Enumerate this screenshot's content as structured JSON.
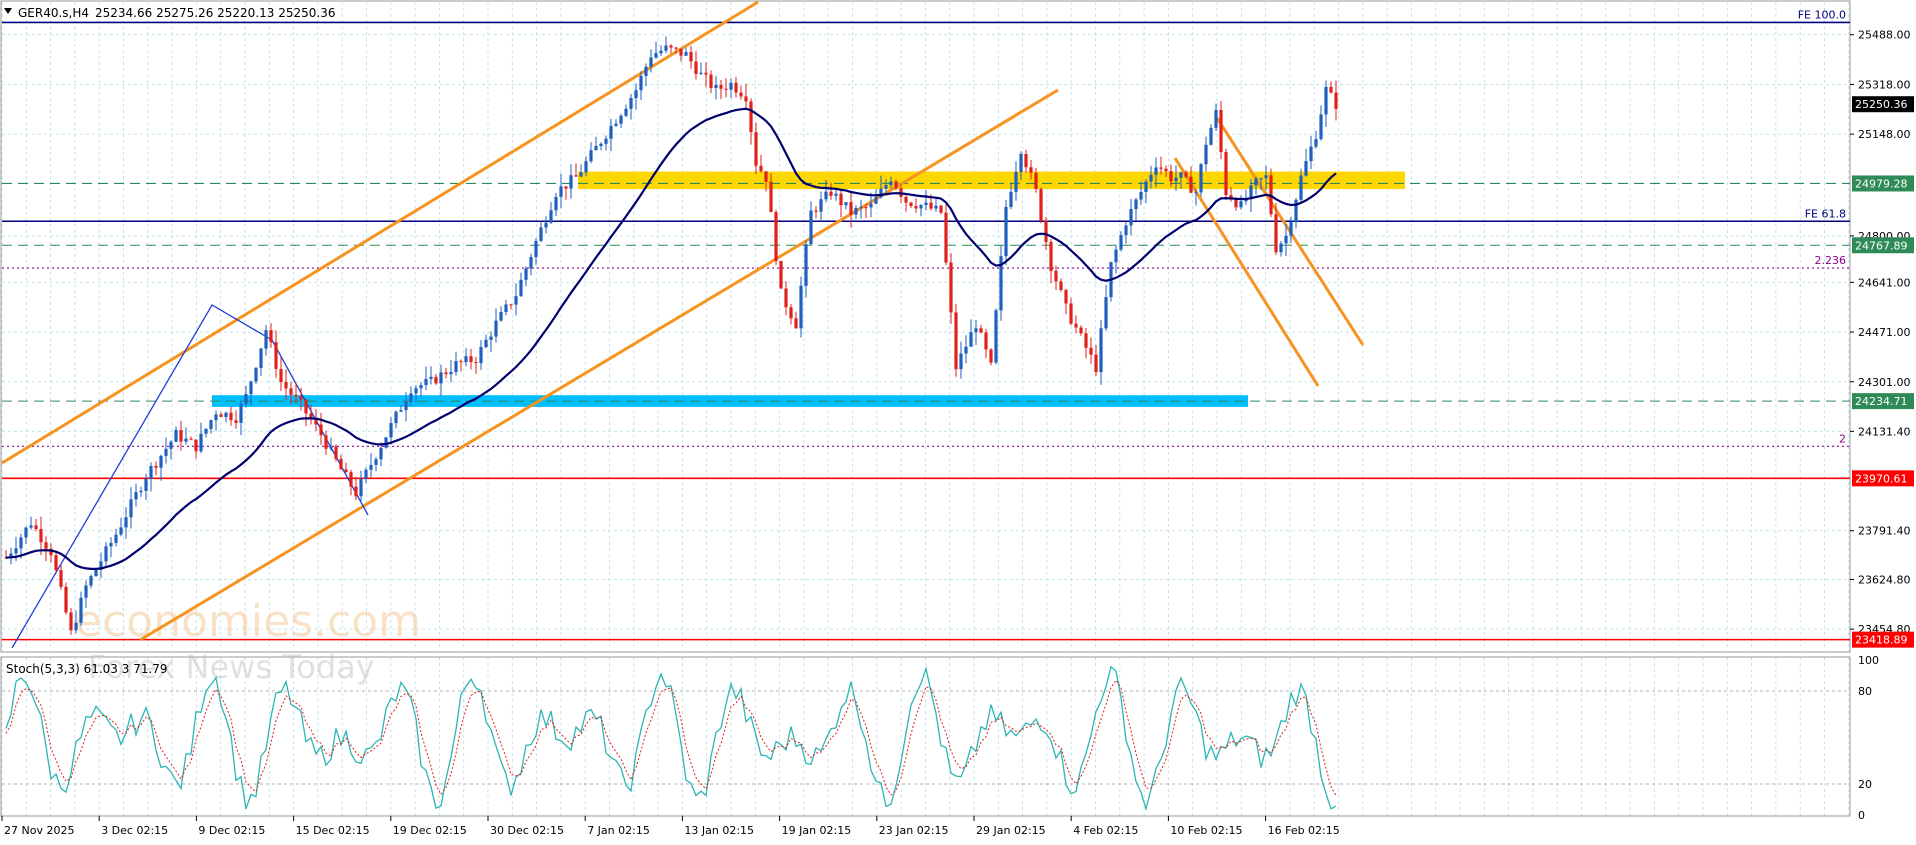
{
  "header": {
    "symbol": "GER40.s,H4",
    "ohlc": "25234.66 25275.26 25220.13 25250.36"
  },
  "watermark": "economies.com",
  "watermark_sub": "Forex News Today",
  "stoch_label": "Stoch(5,3,3) 61.03 3 71.79",
  "chart_data": [
    {
      "type": "candlestick",
      "symbol": "GER40.s",
      "timeframe": "H4",
      "ohlc_last": {
        "open": 25234.66,
        "high": 25275.26,
        "low": 25220.13,
        "close": 25250.36
      },
      "x_tick_labels": [
        "27 Nov 2025",
        "3 Dec 02:15",
        "9 Dec 02:15",
        "15 Dec 02:15",
        "19 Dec 02:15",
        "30 Dec 02:15",
        "7 Jan 02:15",
        "13 Jan 02:15",
        "19 Jan 02:15",
        "23 Jan 02:15",
        "29 Jan 02:15",
        "4 Feb 02:15",
        "10 Feb 02:15",
        "16 Feb 02:15"
      ],
      "y_tick_labels": [
        "25488.00",
        "25318.00",
        "25148.00",
        "24800.00",
        "24641.00",
        "24471.00",
        "24301.00",
        "24131.40",
        "23791.40",
        "23624.80",
        "23454.80"
      ],
      "ylim": [
        23380,
        25600
      ],
      "current_price_tag": "25250.36",
      "price_path": [
        [
          0,
          23700
        ],
        [
          5,
          23820
        ],
        [
          9,
          23720
        ],
        [
          13,
          23440
        ],
        [
          16,
          23600
        ],
        [
          22,
          23780
        ],
        [
          28,
          23980
        ],
        [
          34,
          24120
        ],
        [
          38,
          24080
        ],
        [
          42,
          24200
        ],
        [
          46,
          24180
        ],
        [
          48,
          24250
        ],
        [
          52,
          24480
        ],
        [
          55,
          24300
        ],
        [
          59,
          24220
        ],
        [
          63,
          24120
        ],
        [
          67,
          24000
        ],
        [
          70,
          23920
        ],
        [
          73,
          24020
        ],
        [
          77,
          24150
        ],
        [
          81,
          24280
        ],
        [
          85,
          24300
        ],
        [
          90,
          24360
        ],
        [
          94,
          24380
        ],
        [
          98,
          24500
        ],
        [
          102,
          24600
        ],
        [
          106,
          24780
        ],
        [
          110,
          24950
        ],
        [
          114,
          25000
        ],
        [
          118,
          25100
        ],
        [
          122,
          25200
        ],
        [
          126,
          25300
        ],
        [
          129,
          25420
        ],
        [
          132,
          25440
        ],
        [
          136,
          25420
        ],
        [
          139,
          25350
        ],
        [
          142,
          25300
        ],
        [
          145,
          25320
        ],
        [
          148,
          25280
        ],
        [
          150,
          25050
        ],
        [
          152,
          25000
        ],
        [
          155,
          24600
        ],
        [
          158,
          24500
        ],
        [
          161,
          24880
        ],
        [
          165,
          24950
        ],
        [
          169,
          24880
        ],
        [
          173,
          24900
        ],
        [
          177,
          25000
        ],
        [
          180,
          24920
        ],
        [
          184,
          24900
        ],
        [
          187,
          24880
        ],
        [
          190,
          24350
        ],
        [
          194,
          24500
        ],
        [
          197,
          24350
        ],
        [
          200,
          24900
        ],
        [
          203,
          25100
        ],
        [
          206,
          24950
        ],
        [
          209,
          24700
        ],
        [
          212,
          24550
        ],
        [
          215,
          24450
        ],
        [
          218,
          24350
        ],
        [
          221,
          24700
        ],
        [
          224,
          24850
        ],
        [
          227,
          24950
        ],
        [
          230,
          25050
        ],
        [
          233,
          25000
        ],
        [
          235,
          25000
        ],
        [
          238,
          24950
        ],
        [
          240,
          25120
        ],
        [
          242,
          25220
        ],
        [
          244,
          24950
        ],
        [
          247,
          24900
        ],
        [
          250,
          24980
        ],
        [
          252,
          25000
        ],
        [
          254,
          24760
        ],
        [
          256,
          24800
        ],
        [
          259,
          25000
        ],
        [
          262,
          25150
        ],
        [
          264,
          25300
        ],
        [
          266,
          25250
        ]
      ],
      "horizontal_levels": [
        {
          "label": "FE 100.0",
          "value": 25530,
          "color": "#000080"
        },
        {
          "label": "",
          "value": 24979.28,
          "tag": "24979.28",
          "color": "#2e8b57",
          "style": "dashed"
        },
        {
          "label": "FE 61.8",
          "value": 24850,
          "color": "#000080"
        },
        {
          "label": "",
          "value": 24767.89,
          "tag": "24767.89",
          "color": "#2e8b57",
          "style": "dashed"
        },
        {
          "label": "2.236",
          "value": 24690,
          "color": "#8b008b",
          "style": "dotted"
        },
        {
          "label": "",
          "value": 24234.71,
          "tag": "24234.71",
          "color": "#2e8b57",
          "style": "dashed"
        },
        {
          "label": "2",
          "value": 24080,
          "color": "#8b008b",
          "style": "dotted"
        },
        {
          "label": "",
          "value": 23970.61,
          "tag": "23970.61",
          "color": "#ff0000",
          "style": "solid"
        },
        {
          "label": "",
          "value": 23418.89,
          "tag": "23418.89",
          "color": "#ff0000",
          "style": "solid"
        }
      ],
      "zones": [
        {
          "name": "resistance-zone",
          "color": "#ffd700",
          "y_top": 25020,
          "y_bottom": 24960
        },
        {
          "name": "support-zone",
          "color": "#00bfff",
          "y_top": 24255,
          "y_bottom": 24215
        }
      ]
    },
    {
      "type": "line",
      "indicator": "Stochastic",
      "label": "Stoch(5,3,3) 61.03 3 71.79",
      "ylim": [
        0,
        100
      ],
      "y_tick_labels": [
        "100",
        "80",
        "20",
        "0"
      ],
      "levels": [
        80,
        20
      ]
    }
  ],
  "colors": {
    "bull_candle": "#1e5fbf",
    "bear_candle": "#e0201a",
    "ma_line": "#00006e",
    "channel": "#f7931e",
    "grid": "#b5dfe6",
    "stoch_main": "#2bb5b5",
    "stoch_signal": "#e0201a"
  }
}
